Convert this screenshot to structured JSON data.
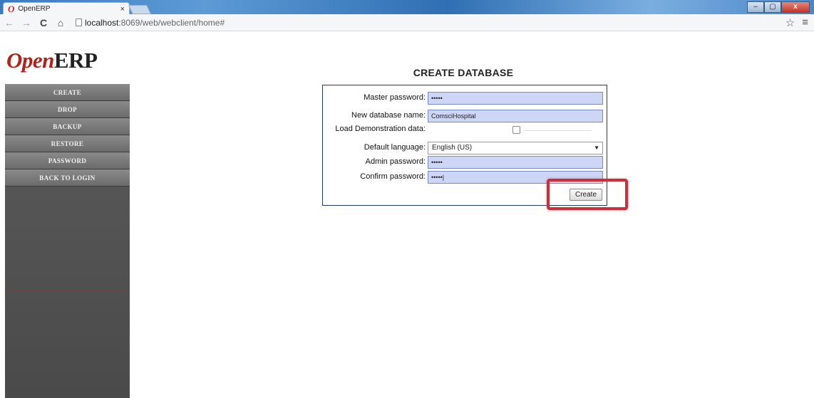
{
  "browser": {
    "tab_title": "OpenERP",
    "tab_logo": "O",
    "tab_close": "×",
    "url_host": "localhost",
    "url_rest": ":8069/web/webclient/home#",
    "window_controls": {
      "minimize": "–",
      "maximize": "▢",
      "close": "x"
    },
    "toolbar_icons": {
      "back": "←",
      "forward": "→",
      "reload": "C",
      "home": "⌂",
      "star": "☆",
      "menu": "≡"
    }
  },
  "sidebar": {
    "logo_open": "Open",
    "logo_erp": "ERP",
    "items": [
      {
        "label": "CREATE"
      },
      {
        "label": "DROP"
      },
      {
        "label": "BACKUP"
      },
      {
        "label": "RESTORE"
      },
      {
        "label": "PASSWORD"
      },
      {
        "label": "BACK TO LOGIN"
      }
    ]
  },
  "main": {
    "title": "CREATE DATABASE",
    "form": {
      "master_password": {
        "label": "Master password:",
        "value": "•••••"
      },
      "db_name": {
        "label": "New database name:",
        "value": "ComsciHospital"
      },
      "demo_data": {
        "label": "Load Demonstration data:",
        "checked": false
      },
      "language": {
        "label": "Default language:",
        "value": "English (US)",
        "arrow": "▼"
      },
      "admin_password": {
        "label": "Admin password:",
        "value": "•••••"
      },
      "confirm_password": {
        "label": "Confirm password:",
        "value": "•••••|"
      }
    },
    "create_button": "Create",
    "highlight_color": "#c8313b"
  }
}
